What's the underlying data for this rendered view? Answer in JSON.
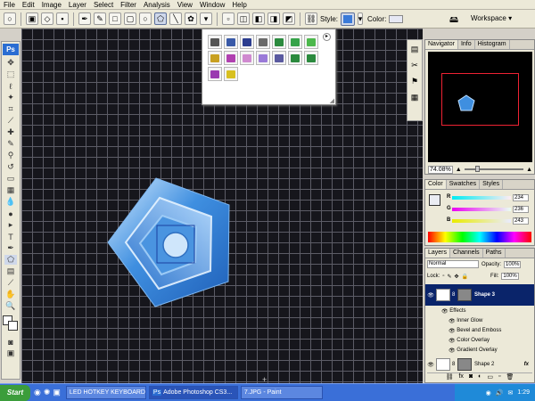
{
  "menu": [
    "File",
    "Edit",
    "Image",
    "Layer",
    "Select",
    "Filter",
    "Analysis",
    "View",
    "Window",
    "Help"
  ],
  "options": {
    "style_label": "Style:",
    "color_label": "Color:",
    "workspace_label": "Workspace ▾"
  },
  "tools": {
    "ps_label": "Ps"
  },
  "style_swatches": [
    {
      "name": "style-swatch",
      "color": "#555555"
    },
    {
      "name": "style-swatch",
      "color": "#3a5aa8"
    },
    {
      "name": "style-swatch",
      "color": "#2c3d8f"
    },
    {
      "name": "style-swatch",
      "color": "#6a6a6a"
    },
    {
      "name": "style-swatch",
      "color": "#2b8a3e"
    },
    {
      "name": "style-swatch",
      "color": "#36a34a"
    },
    {
      "name": "style-swatch",
      "color": "#4cb84c"
    },
    {
      "name": "style-swatch",
      "color": "#c8a020"
    },
    {
      "name": "style-swatch",
      "color": "#b040b0"
    },
    {
      "name": "style-swatch",
      "color": "#d08ad0"
    },
    {
      "name": "style-swatch",
      "color": "#9a7ad8"
    },
    {
      "name": "style-swatch",
      "color": "#5a5aa0"
    },
    {
      "name": "style-swatch",
      "color": "#2b8a3e"
    },
    {
      "name": "style-swatch",
      "color": "#2b8a3e"
    },
    {
      "name": "style-swatch",
      "color": "#9a3ab0"
    },
    {
      "name": "style-swatch",
      "color": "#d8c020"
    }
  ],
  "navigator": {
    "tabs": [
      "Navigator",
      "Info",
      "Histogram"
    ],
    "zoom": "74.08%"
  },
  "color_panel": {
    "tabs": [
      "Color",
      "Swatches",
      "Styles"
    ],
    "r": "234",
    "g": "236",
    "b": "243",
    "r_label": "R",
    "g_label": "G",
    "b_label": "B"
  },
  "layers_panel": {
    "tabs": [
      "Layers",
      "Channels",
      "Paths"
    ],
    "blend_mode": "Normal",
    "opacity_label": "Opacity:",
    "opacity": "100%",
    "lock_label": "Lock:",
    "fill_label": "Fill:",
    "fill": "100%",
    "rows": [
      "Shape 3",
      "Effects",
      "Inner Glow",
      "Bevel and Emboss",
      "Color Overlay",
      "Gradient Overlay",
      "Shape 2"
    ]
  },
  "taskbar": {
    "start": "Start",
    "tasks": [
      "LED HOTKEY KEYBOARD",
      "Adobe Photoshop CS3...",
      "7.JPG - Paint"
    ],
    "clock": "1:29"
  }
}
